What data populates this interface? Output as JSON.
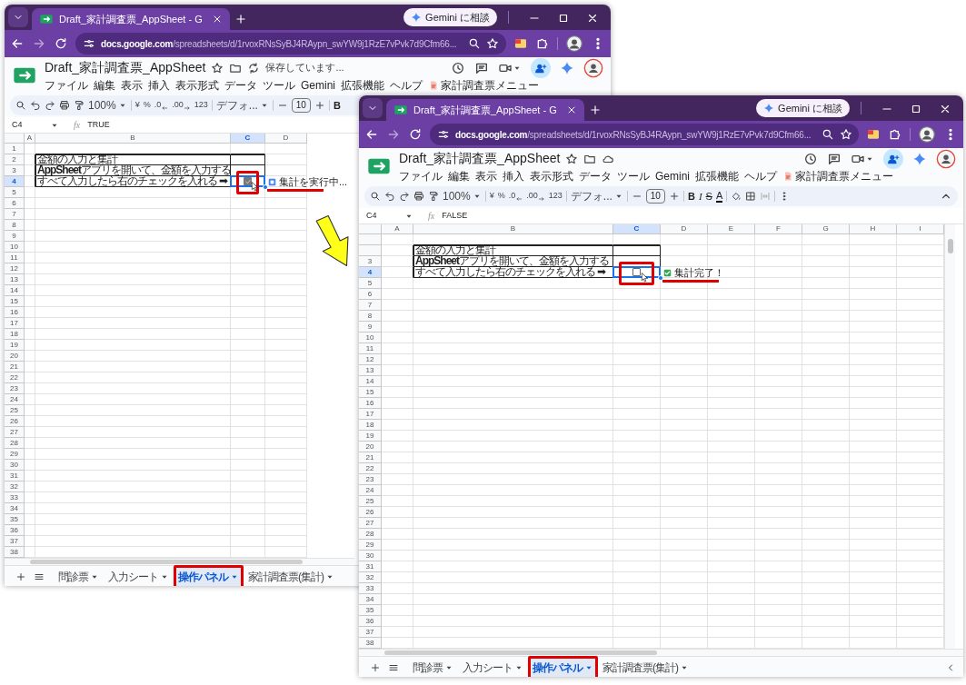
{
  "windows": [
    {
      "browser_tab": {
        "title": "Draft_家計調査票_AppSheet - G"
      },
      "gemini_button": "Gemini に相談",
      "url": {
        "host": "docs.google.com",
        "path": "/spreadsheets/d/1rvoxRNsSyBJ4RAypn_swYW9j1RzE7vPvk7d9Cfm66..."
      },
      "doc_title": "Draft_家計調査票_AppSheet",
      "save_status": "保存しています...",
      "menu": [
        "ファイル",
        "編集",
        "表示",
        "挿入",
        "表示形式",
        "データ",
        "ツール",
        "Gemini",
        "拡張機能",
        "ヘルプ"
      ],
      "addon_menu": "家計調査票メニュー",
      "toolbar": [
        {
          "kind": "search"
        },
        {
          "kind": "undo"
        },
        {
          "kind": "redo"
        },
        {
          "kind": "print"
        },
        {
          "kind": "paint"
        },
        {
          "kind": "dropdown",
          "label": "100%"
        },
        {
          "kind": "separator"
        },
        {
          "kind": "text",
          "label": "¥"
        },
        {
          "kind": "text",
          "label": "%"
        },
        {
          "kind": "decrease",
          "label": ".0"
        },
        {
          "kind": "increase",
          "label": ".00"
        },
        {
          "kind": "text",
          "label": "123"
        },
        {
          "kind": "separator"
        },
        {
          "kind": "dropdown",
          "label": "デフォ..."
        },
        {
          "kind": "separator"
        },
        {
          "kind": "minus"
        },
        {
          "kind": "field",
          "label": "10"
        },
        {
          "kind": "plus"
        },
        {
          "kind": "separator"
        },
        {
          "kind": "bold",
          "label": "B"
        }
      ],
      "formula_bar": {
        "cell": "C4",
        "function_label": "fx",
        "value": "TRUE"
      },
      "columns": [
        {
          "label": "A",
          "selected": false
        },
        {
          "label": "B",
          "selected": false
        },
        {
          "label": "C",
          "selected": true
        },
        {
          "label": "D",
          "selected": false
        }
      ],
      "rows": [
        {
          "number": "1",
          "selected": false
        },
        {
          "number": "2",
          "selected": false,
          "cells": {
            "B": {
              "text": "金額の入力と集計",
              "bordered": true
            },
            "C": {
              "bordered": true
            }
          }
        },
        {
          "number": "3",
          "selected": false,
          "cells": {
            "B": {
              "text": "**AppSheet**アプリを開いて、金額を入力する",
              "bordered": true
            },
            "C": {
              "bordered": true
            }
          }
        },
        {
          "number": "4",
          "selected": true,
          "cells": {
            "B": {
              "text": "すべて入力したら右のチェックを入れる ➡",
              "bordered": true
            },
            "C": {
              "kind": "checkbox",
              "checked": true,
              "bordered": true,
              "highlighted": true,
              "pointer": true
            },
            "D": {
              "kind": "pending",
              "text": "集計を実行中...",
              "underlined": true
            }
          }
        },
        {
          "number": "5",
          "selected": false
        },
        {
          "number": "6",
          "selected": false
        },
        {
          "number": "7",
          "selected": false
        },
        {
          "number": "8",
          "selected": false
        },
        {
          "number": "9",
          "selected": false
        },
        {
          "number": "10",
          "selected": false
        },
        {
          "number": "11",
          "selected": false
        },
        {
          "number": "12",
          "selected": false
        },
        {
          "number": "13",
          "selected": false
        },
        {
          "number": "14",
          "selected": false
        },
        {
          "number": "15",
          "selected": false
        },
        {
          "number": "16",
          "selected": false
        },
        {
          "number": "17",
          "selected": false
        },
        {
          "number": "18",
          "selected": false
        },
        {
          "number": "19",
          "selected": false
        },
        {
          "number": "20",
          "selected": false
        },
        {
          "number": "21",
          "selected": false
        },
        {
          "number": "22",
          "selected": false
        },
        {
          "number": "23",
          "selected": false
        },
        {
          "number": "24",
          "selected": false
        },
        {
          "number": "25",
          "selected": false
        },
        {
          "number": "26",
          "selected": false
        },
        {
          "number": "27",
          "selected": false
        },
        {
          "number": "28",
          "selected": false
        },
        {
          "number": "29",
          "selected": false
        },
        {
          "number": "30",
          "selected": false
        },
        {
          "number": "31",
          "selected": false
        },
        {
          "number": "32",
          "selected": false
        },
        {
          "number": "33",
          "selected": false
        },
        {
          "number": "34",
          "selected": false
        },
        {
          "number": "35",
          "selected": false
        },
        {
          "number": "36",
          "selected": false
        },
        {
          "number": "37",
          "selected": false
        },
        {
          "number": "38",
          "selected": false
        }
      ],
      "sheet_tabs": [
        {
          "label": "問診票",
          "selected": false,
          "highlighted": false
        },
        {
          "label": "入力シート",
          "selected": false,
          "highlighted": false
        },
        {
          "label": "操作パネル",
          "selected": true,
          "highlighted": true
        },
        {
          "label": "家計調査票(集計)",
          "selected": false,
          "highlighted": false
        }
      ]
    },
    {
      "browser_tab": {
        "title": "Draft_家計調査票_AppSheet - G"
      },
      "gemini_button": "Gemini に相談",
      "url": {
        "host": "docs.google.com",
        "path": "/spreadsheets/d/1rvoxRNsSyBJ4RAypn_swYW9j1RzE7vPvk7d9Cfm66..."
      },
      "doc_title": "Draft_家計調査票_AppSheet",
      "menu": [
        "ファイル",
        "編集",
        "表示",
        "挿入",
        "表示形式",
        "データ",
        "ツール",
        "Gemini",
        "拡張機能",
        "ヘルプ"
      ],
      "addon_menu": "家計調査票メニュー",
      "toolbar": [
        {
          "kind": "search"
        },
        {
          "kind": "undo"
        },
        {
          "kind": "redo"
        },
        {
          "kind": "print"
        },
        {
          "kind": "paint"
        },
        {
          "kind": "dropdown",
          "label": "100%"
        },
        {
          "kind": "separator"
        },
        {
          "kind": "text",
          "label": "¥"
        },
        {
          "kind": "text",
          "label": "%"
        },
        {
          "kind": "decrease",
          "label": ".0"
        },
        {
          "kind": "increase",
          "label": ".00"
        },
        {
          "kind": "text",
          "label": "123"
        },
        {
          "kind": "separator"
        },
        {
          "kind": "dropdown",
          "label": "デフォ..."
        },
        {
          "kind": "separator"
        },
        {
          "kind": "minus"
        },
        {
          "kind": "field",
          "label": "10"
        },
        {
          "kind": "plus"
        },
        {
          "kind": "separator"
        },
        {
          "kind": "bold",
          "label": "B"
        },
        {
          "kind": "italic",
          "label": "I"
        },
        {
          "kind": "strike",
          "label": "S"
        },
        {
          "kind": "color",
          "label": "A"
        },
        {
          "kind": "separator"
        },
        {
          "kind": "fill"
        },
        {
          "kind": "borders"
        },
        {
          "kind": "merge"
        },
        {
          "kind": "separator"
        },
        {
          "kind": "more"
        },
        {
          "kind": "collapse"
        }
      ],
      "formula_bar": {
        "cell": "C4",
        "function_label": "fx",
        "value": "FALSE"
      },
      "columns": [
        {
          "label": "A",
          "selected": false
        },
        {
          "label": "B",
          "selected": false
        },
        {
          "label": "C",
          "selected": true
        },
        {
          "label": "D",
          "selected": false
        },
        {
          "label": "E",
          "selected": false
        },
        {
          "label": "F",
          "selected": false
        },
        {
          "label": "G",
          "selected": false
        },
        {
          "label": "H",
          "selected": false
        },
        {
          "label": "I",
          "selected": false
        }
      ],
      "rows": [
        {
          "selected": false
        },
        {
          "selected": false,
          "cells": {
            "B": {
              "text": "金額の入力と集計",
              "bordered": true
            },
            "C": {
              "bordered": true
            }
          }
        },
        {
          "number": "3",
          "selected": false,
          "cells": {
            "B": {
              "text": "**AppSheet**アプリを開いて、金額を入力する",
              "bordered": true
            },
            "C": {
              "bordered": true
            }
          }
        },
        {
          "number": "4",
          "selected": true,
          "cells": {
            "B": {
              "text": "すべて入力したら右のチェックを入れる ➡",
              "bordered": true
            },
            "C": {
              "kind": "checkbox",
              "checked": false,
              "bordered": true,
              "highlighted": true,
              "pointer": true
            },
            "D": {
              "kind": "done",
              "text": "集計完了！",
              "underlined": true
            }
          }
        },
        {
          "number": "5",
          "selected": false
        },
        {
          "number": "6",
          "selected": false
        },
        {
          "number": "7",
          "selected": false
        },
        {
          "number": "8",
          "selected": false
        },
        {
          "number": "9",
          "selected": false
        },
        {
          "number": "10",
          "selected": false
        },
        {
          "number": "11",
          "selected": false
        },
        {
          "number": "12",
          "selected": false
        },
        {
          "number": "13",
          "selected": false
        },
        {
          "number": "14",
          "selected": false
        },
        {
          "number": "15",
          "selected": false
        },
        {
          "number": "16",
          "selected": false
        },
        {
          "number": "17",
          "selected": false
        },
        {
          "number": "18",
          "selected": false
        },
        {
          "number": "19",
          "selected": false
        },
        {
          "number": "20",
          "selected": false
        },
        {
          "number": "21",
          "selected": false
        },
        {
          "number": "22",
          "selected": false
        },
        {
          "number": "23",
          "selected": false
        },
        {
          "number": "24",
          "selected": false
        },
        {
          "number": "25",
          "selected": false
        },
        {
          "number": "26",
          "selected": false
        },
        {
          "number": "27",
          "selected": false
        },
        {
          "number": "28",
          "selected": false
        },
        {
          "number": "29",
          "selected": false
        },
        {
          "number": "30",
          "selected": false
        },
        {
          "number": "31",
          "selected": false
        },
        {
          "number": "32",
          "selected": false
        },
        {
          "number": "33",
          "selected": false
        },
        {
          "number": "34",
          "selected": false
        },
        {
          "number": "35",
          "selected": false
        },
        {
          "number": "36",
          "selected": false
        },
        {
          "number": "37",
          "selected": false
        },
        {
          "number": "38",
          "selected": false
        }
      ],
      "sheet_tabs": [
        {
          "label": "問診票",
          "selected": false,
          "highlighted": false
        },
        {
          "label": "入力シート",
          "selected": false,
          "highlighted": false
        },
        {
          "label": "操作パネル",
          "selected": true,
          "highlighted": true
        },
        {
          "label": "家計調査票(集計)",
          "selected": false,
          "highlighted": false
        }
      ]
    }
  ]
}
